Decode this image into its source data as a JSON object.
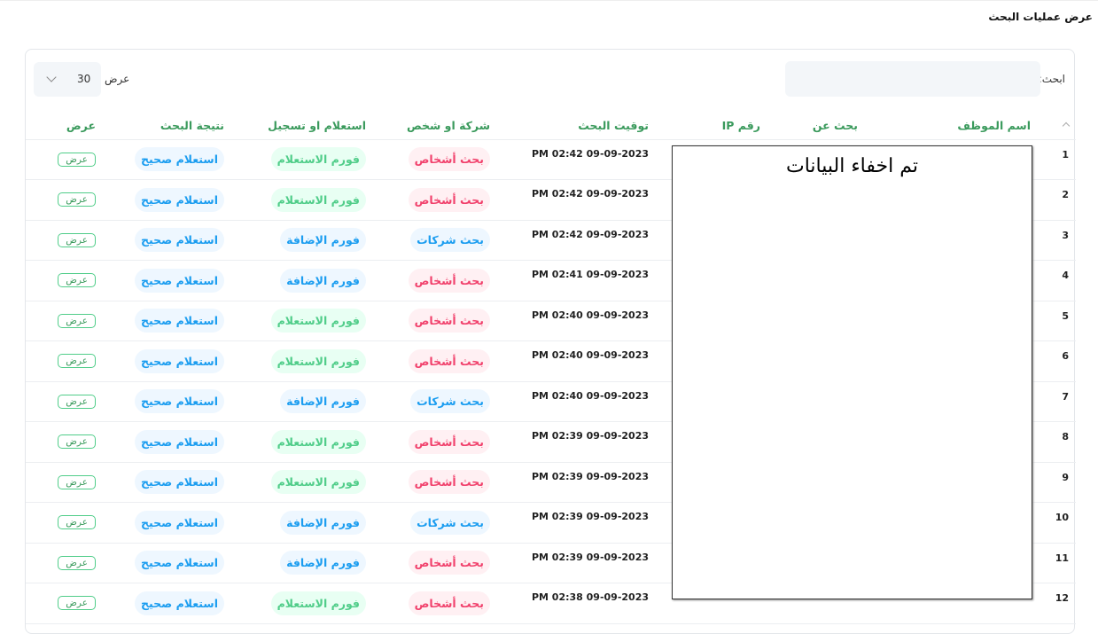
{
  "page_title": "عرض عمليات البحث",
  "search": {
    "label": "ابحث:",
    "value": ""
  },
  "length": {
    "label": "عرض",
    "value": "30"
  },
  "columns": [
    "اسم الموظف",
    "بحث عن",
    "رقم IP",
    "توقيت البحث",
    "شركة او شخص",
    "استعلام او تسجيل",
    "نتيجة البحث",
    "عرض"
  ],
  "mask_text": "تم اخفاء البيانات",
  "rows": [
    {
      "n": "1",
      "time": "PM 02:42 09-09-2023",
      "type": "بحث أشخاص",
      "form": "فورم الاستعلام",
      "result": "استعلام صحيح",
      "view": "عرض"
    },
    {
      "n": "2",
      "time": "PM 02:42 09-09-2023",
      "type": "بحث أشخاص",
      "form": "فورم الاستعلام",
      "result": "استعلام صحيح",
      "view": "عرض"
    },
    {
      "n": "3",
      "time": "PM 02:42 09-09-2023",
      "type": "بحث شركات",
      "form": "فورم الإضافة",
      "result": "استعلام صحيح",
      "view": "عرض"
    },
    {
      "n": "4",
      "time": "PM 02:41 09-09-2023",
      "type": "بحث أشخاص",
      "form": "فورم الإضافة",
      "result": "استعلام صحيح",
      "view": "عرض"
    },
    {
      "n": "5",
      "time": "PM 02:40 09-09-2023",
      "type": "بحث أشخاص",
      "form": "فورم الاستعلام",
      "result": "استعلام صحيح",
      "view": "عرض"
    },
    {
      "n": "6",
      "time": "PM 02:40 09-09-2023",
      "type": "بحث أشخاص",
      "form": "فورم الاستعلام",
      "result": "استعلام صحيح",
      "view": "عرض"
    },
    {
      "n": "7",
      "time": "PM 02:40 09-09-2023",
      "type": "بحث شركات",
      "form": "فورم الإضافة",
      "result": "استعلام صحيح",
      "view": "عرض"
    },
    {
      "n": "8",
      "time": "PM 02:39 09-09-2023",
      "type": "بحث أشخاص",
      "form": "فورم الاستعلام",
      "result": "استعلام صحيح",
      "view": "عرض"
    },
    {
      "n": "9",
      "time": "PM 02:39 09-09-2023",
      "type": "بحث أشخاص",
      "form": "فورم الاستعلام",
      "result": "استعلام صحيح",
      "view": "عرض"
    },
    {
      "n": "10",
      "time": "PM 02:39 09-09-2023",
      "type": "بحث شركات",
      "form": "فورم الإضافة",
      "result": "استعلام صحيح",
      "view": "عرض"
    },
    {
      "n": "11",
      "time": "PM 02:39 09-09-2023",
      "type": "بحث أشخاص",
      "form": "فورم الإضافة",
      "result": "استعلام صحيح",
      "view": "عرض"
    },
    {
      "n": "12",
      "time": "PM 02:38 09-09-2023",
      "type": "بحث أشخاص",
      "form": "فورم الاستعلام",
      "result": "استعلام صحيح",
      "view": "عرض"
    }
  ]
}
